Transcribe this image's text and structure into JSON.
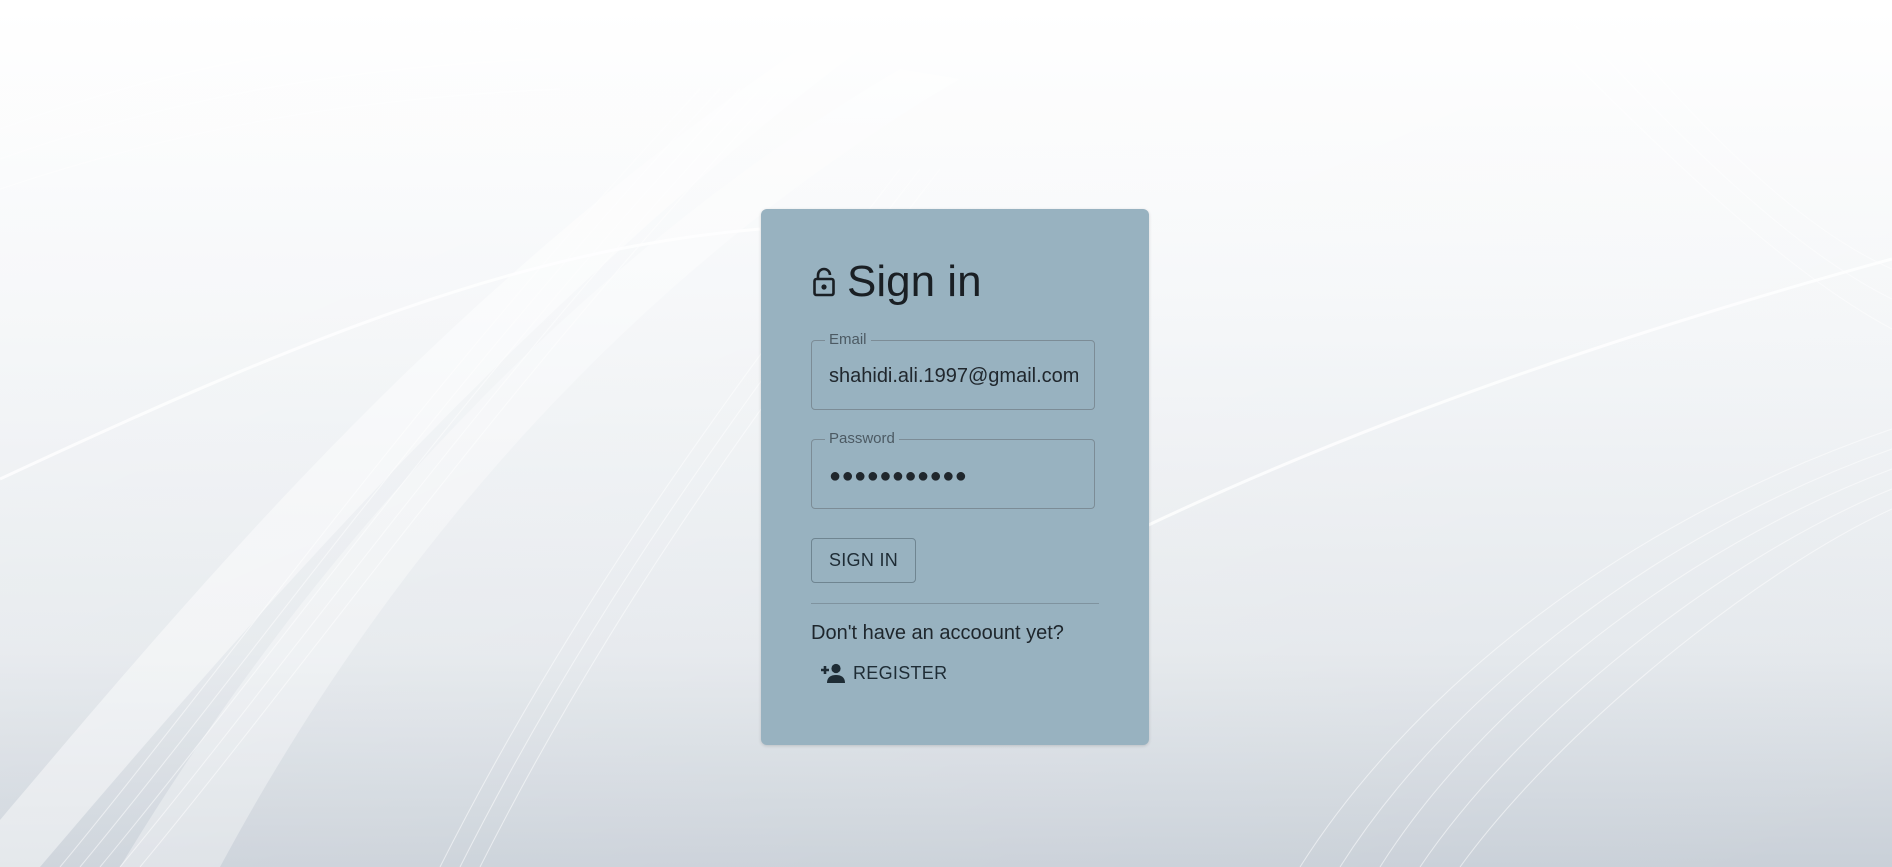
{
  "signin": {
    "title": "Sign in",
    "lock_icon": "lock-icon",
    "email_label": "Email",
    "email_value": "shahidi.ali.1997@gmail.com",
    "password_label": "Password",
    "password_value": "●●●●●●●●●●●",
    "submit_label": "SIGN IN",
    "register_prompt": "Don't have an accoount yet?",
    "register_icon": "person-add-icon",
    "register_label": "REGISTER"
  },
  "colors": {
    "card_background": "#98b2c0",
    "text_primary": "#1a1f24",
    "page_background": "#ffffff"
  }
}
